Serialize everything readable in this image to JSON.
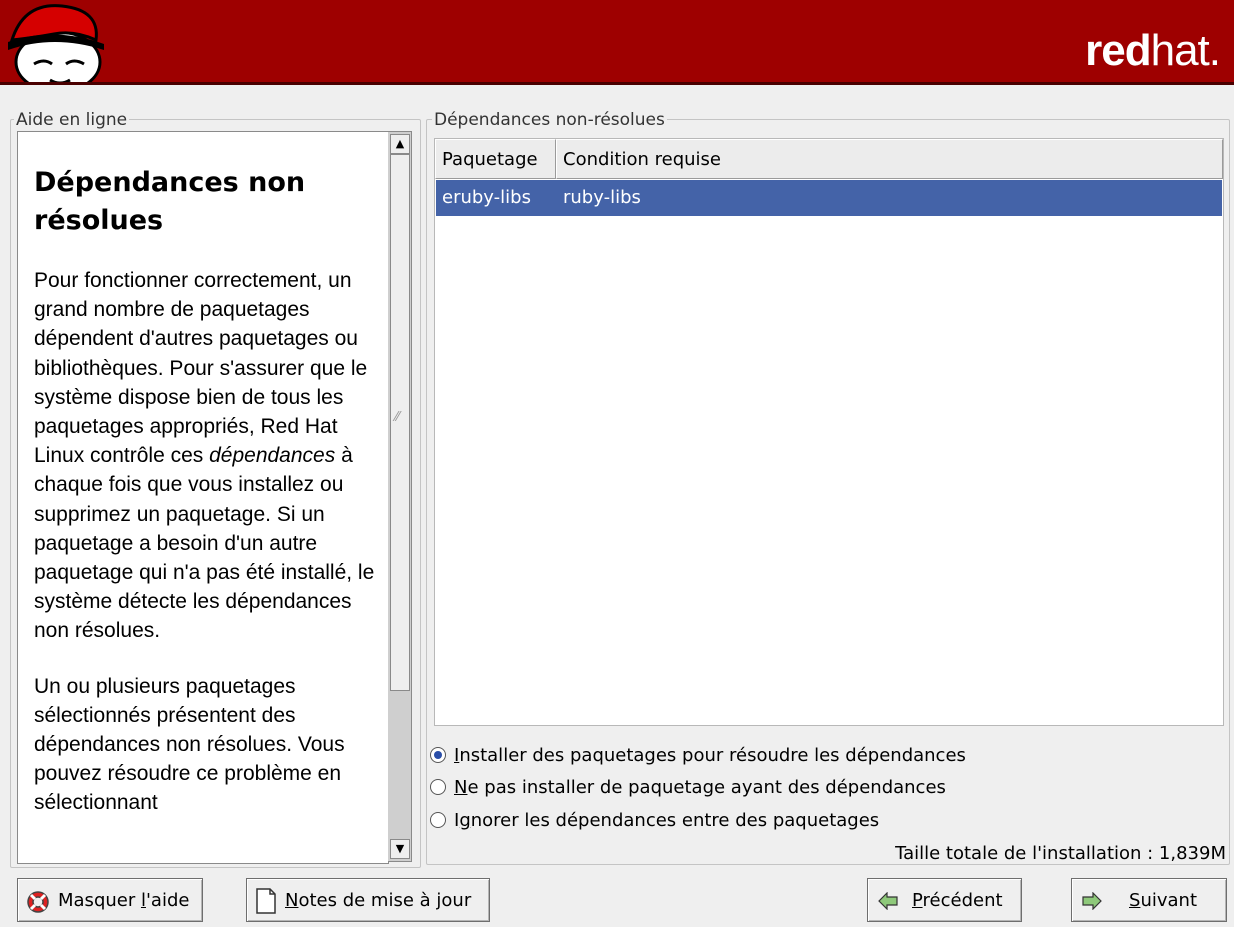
{
  "banner": {
    "brand_bold": "red",
    "brand_light": "hat."
  },
  "help_pane": {
    "label": "Aide en ligne",
    "title": "Dépendances non résolues",
    "para1_a": "Pour fonctionner correctement, un grand nombre de paquetages dépendent d'autres paquetages ou bibliothèques. Pour s'assurer que le système dispose bien de tous les paquetages appropriés, Red Hat Linux contrôle ces ",
    "para1_em": "dépendances",
    "para1_b": " à chaque fois que vous installez ou supprimez un paquetage. Si un paquetage a besoin d'un autre paquetage qui n'a pas été installé, le système détecte les dépendances non résolues.",
    "para2": "Un ou plusieurs paquetages sélectionnés présentent des dépendances non résolues. Vous pouvez résoudre ce problème en sélectionnant"
  },
  "deps_frame": {
    "label": "Dépendances non-résolues",
    "columns": [
      "Paquetage",
      "Condition requise"
    ],
    "rows": [
      {
        "package": "eruby-libs",
        "requires": "ruby-libs",
        "selected": true
      }
    ]
  },
  "options": {
    "install": {
      "mnemonic": "I",
      "rest": "nstaller des paquetages pour résoudre les dépendances",
      "selected": true
    },
    "no_install": {
      "mnemonic": "N",
      "rest": "e pas installer de paquetage ayant des dépendances",
      "selected": false
    },
    "ignore": {
      "pre": "I",
      "mnemonic": "g",
      "rest": "norer les dépendances entre des paquetages",
      "selected": false
    }
  },
  "install_size": "Taille totale de l'installation : 1,839M",
  "buttons": {
    "hide_help": {
      "pre": "Masquer ",
      "mnemonic": "l",
      "rest": "'aide",
      "icon": "lifebuoy-icon"
    },
    "release_notes": {
      "mnemonic": "N",
      "rest": "otes de mise à jour",
      "icon": "document-icon"
    },
    "back": {
      "mnemonic": "P",
      "rest": "récédent",
      "icon": "arrow-left-icon"
    },
    "next": {
      "mnemonic": "S",
      "rest": "uivant",
      "icon": "arrow-right-icon"
    }
  },
  "colors": {
    "banner": "#9e0000",
    "selection": "#4463a8",
    "window": "#efefef"
  }
}
